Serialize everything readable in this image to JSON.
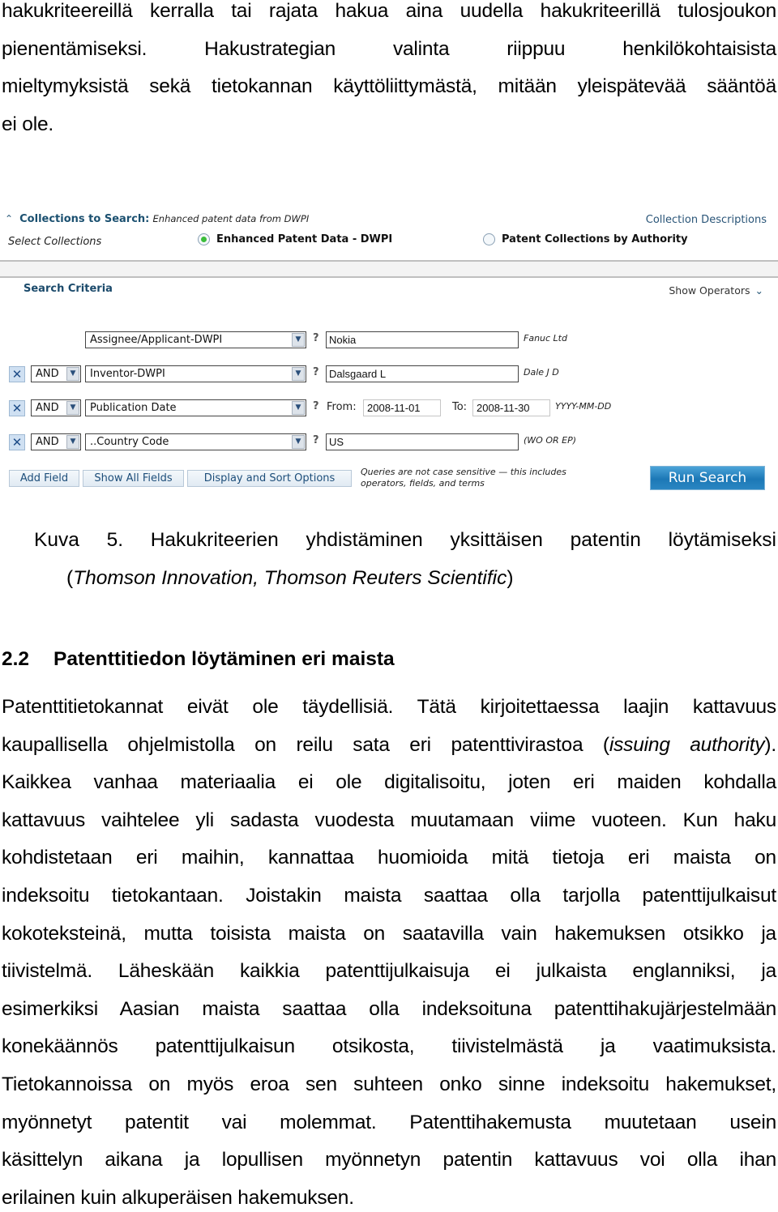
{
  "top_paragraph": {
    "lines": [
      "hakukriteereillä kerralla tai rajata hakua aina uudella hakukriteerillä tulosjoukon",
      "pienentämiseksi. Hakustrategian valinta riippuu henkilökohtaisista",
      "mieltymyksistä sekä tietokannan käyttöliittymästä, mitään yleispätevää sääntöä",
      "ei ole."
    ]
  },
  "figure": {
    "collections": {
      "title": "Collections to Search:",
      "subtitle": "Enhanced patent data from DWPI",
      "descriptions_link": "Collection Descriptions",
      "select_label": "Select Collections",
      "options": [
        {
          "label": "Enhanced Patent Data - DWPI",
          "selected": true
        },
        {
          "label": "Patent Collections by Authority",
          "selected": false
        }
      ]
    },
    "search_criteria": {
      "title": "Search Criteria",
      "show_operators": "Show Operators",
      "rows": [
        {
          "operator": null,
          "field": "Assignee/Applicant-DWPI",
          "value": "Nokia",
          "hint": "Fanuc Ltd"
        },
        {
          "operator": "AND",
          "field": "Inventor-DWPI",
          "value": "Dalsgaard L",
          "hint": "Dale J D"
        },
        {
          "operator": "AND",
          "field": "Publication Date",
          "from_label": "From:",
          "from_value": "2008-11-01",
          "to_label": "To:",
          "to_value": "2008-11-30",
          "hint": "YYYY-MM-DD"
        },
        {
          "operator": "AND",
          "field": "..Country Code",
          "value": "US",
          "hint": "(WO OR EP)"
        }
      ],
      "help_glyph": "?",
      "remove_glyph": "✕"
    },
    "buttons": {
      "add_field": "Add Field",
      "show_all_fields": "Show All Fields",
      "display_sort": "Display and Sort Options",
      "run_search": "Run Search"
    },
    "note_line1": "Queries are not case sensitive — this includes",
    "note_line2": "operators, fields, and terms"
  },
  "caption": {
    "label": "Kuva 5.",
    "line1_words": [
      "Hakukriteerien",
      "yhdistäminen",
      "yksittäisen",
      "patentin",
      "löytämiseksi"
    ],
    "line2_open": "(",
    "line2_italic": "Thomson Innovation, Thomson Reuters Scientific",
    "line2_close": ")"
  },
  "section": {
    "number": "2.2",
    "title": "Patenttitiedon löytäminen eri maista"
  },
  "body_paragraph": {
    "lines": [
      "Patenttitietokannat eivät ole täydellisiä. Tätä kirjoitettaessa laajin kattavuus",
      "kaupallisella ohjelmistolla on reilu sata eri patenttivirastoa (",
      "Kaikkea vanhaa materiaalia ei ole digitalisoitu, joten eri maiden kohdalla",
      "kattavuus vaihtelee yli sadasta vuodesta muutamaan viime vuoteen. Kun haku",
      "kohdistetaan eri maihin, kannattaa huomioida mitä tietoja eri maista on",
      "indeksoitu tietokantaan. Joistakin maista saattaa olla tarjolla patenttijulkaisut",
      "kokoteksteinä, mutta toisista maista on saatavilla vain hakemuksen otsikko ja",
      "tiivistelmä. Läheskään kaikkia patenttijulkaisuja ei julkaista englanniksi, ja",
      "esimerkiksi Aasian maista saattaa olla indeksoituna patenttihakujärjestelmään",
      "konekäännös patenttijulkaisun otsikosta, tiivistelmästä ja vaatimuksista.",
      "Tietokannoissa on myös eroa sen suhteen onko sinne indeksoitu hakemukset,",
      "myönnetyt patentit vai molemmat. Patenttihakemusta muutetaan usein",
      "käsittelyn aikana ja lopullisen myönnetyn patentin kattavuus voi olla ihan",
      "erilainen kuin alkuperäisen hakemuksen."
    ],
    "line2_italic": "issuing authority",
    "line2_close": ")."
  }
}
